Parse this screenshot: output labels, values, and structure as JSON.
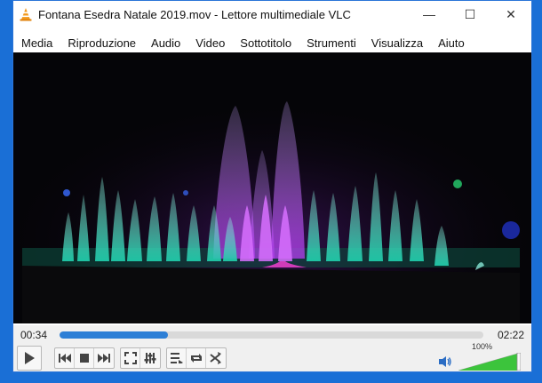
{
  "window": {
    "title": "Fontana Esedra Natale 2019.mov - Lettore multimediale VLC",
    "controls": {
      "minimize": "—",
      "maximize": "☐",
      "close": "✕"
    }
  },
  "menu": [
    {
      "label": "Media"
    },
    {
      "label": "Riproduzione"
    },
    {
      "label": "Audio"
    },
    {
      "label": "Video"
    },
    {
      "label": "Sottotitolo"
    },
    {
      "label": "Strumenti"
    },
    {
      "label": "Visualizza"
    },
    {
      "label": "Aiuto"
    }
  ],
  "playback": {
    "elapsed": "00:34",
    "duration": "02:22",
    "progress": 0.255
  },
  "volume": {
    "label": "100%",
    "level": 1.0
  },
  "icons": {
    "app": "vlc-cone-icon",
    "play": "play-icon",
    "previous": "previous-icon",
    "stop": "stop-icon",
    "next": "next-icon",
    "fullscreen": "fullscreen-icon",
    "extended": "extended-settings-icon",
    "playlist": "playlist-icon",
    "loop": "loop-icon",
    "shuffle": "shuffle-icon",
    "speaker": "speaker-icon"
  },
  "colors": {
    "accent": "#2d7fd6",
    "volume_green": "#3cc43c",
    "desktop": "#1a6fd6"
  }
}
